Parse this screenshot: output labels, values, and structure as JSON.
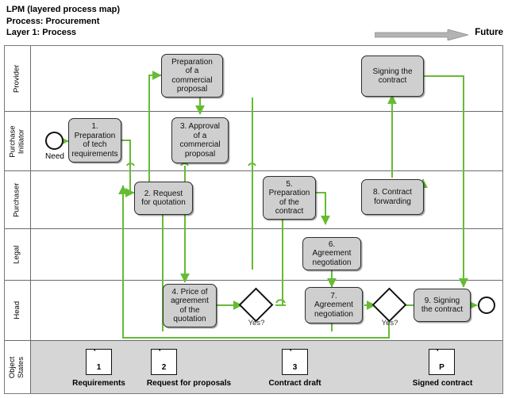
{
  "header": {
    "title_lines": "LPM (layered process map)\nProcess: Procurement\nLayer 1: Process",
    "future_label": "Future",
    "arrow_icon": "right-arrow-icon"
  },
  "lanes": [
    {
      "id": "provider",
      "label": "Provider"
    },
    {
      "id": "purchase-initiator",
      "label": "Purchase\nInitiator"
    },
    {
      "id": "purchaser",
      "label": "Purchaser"
    },
    {
      "id": "legal",
      "label": "Legal"
    },
    {
      "id": "head",
      "label": "Head"
    },
    {
      "id": "object-states",
      "label": "Object\nStates"
    }
  ],
  "nodes": {
    "provider_proposal": "Preparation\nof a\ncommercial\nproposal",
    "provider_signing": "Signing the\ncontract",
    "n1": "1.\nPreparation\nof tech\nrequirements",
    "n3": "3. Approval\nof a\ncommercial\nproposal",
    "n2": "2. Request\nfor quotation",
    "n5": "5.\nPreparation\nof the\ncontract",
    "n8": "8. Contract\nforwarding",
    "n6": "6.\nAgreement\nnegotiation",
    "n4": "4. Price of\nagreement\nof the\nquotation",
    "n7": "7.\nAgreement\nnegotiation",
    "n9": "9. Signing\nthe contract"
  },
  "events": {
    "start_label": "Need",
    "end_label": ""
  },
  "gateways": {
    "g1_label": "Yes?",
    "g2_label": "Yes?"
  },
  "object_states": [
    {
      "marker": "1",
      "label": "Requirements"
    },
    {
      "marker": "2",
      "label": "Request for proposals"
    },
    {
      "marker": "3",
      "label": "Contract draft"
    },
    {
      "marker": "P",
      "label": "Signed contract"
    }
  ],
  "colors": {
    "flow": "#66bb33",
    "node_fill": "#cfcfcf",
    "node_border": "#2e2e2e",
    "band_fill": "#d6d6d6",
    "arrow_gray": "#b3b3b3"
  }
}
